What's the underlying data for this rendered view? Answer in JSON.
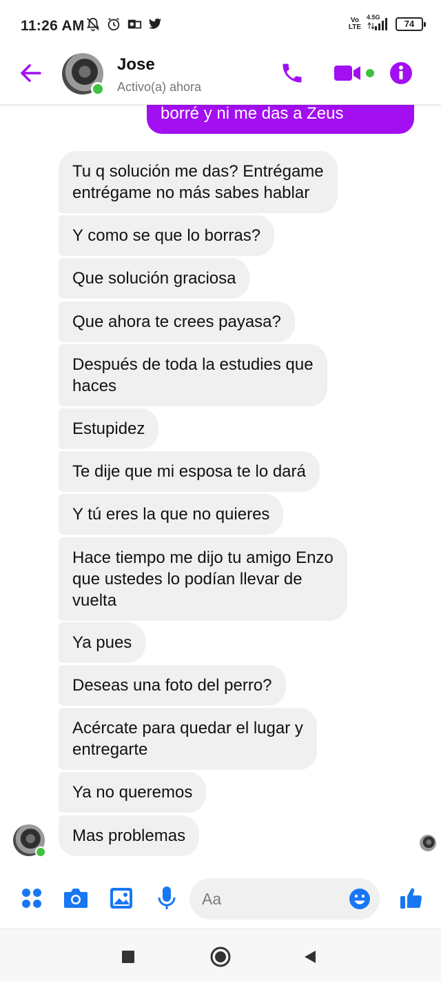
{
  "status_bar": {
    "time": "11:26 AM",
    "network_top": "Vo",
    "network_bottom": "LTE",
    "signal_label": "4.5G",
    "battery": "74"
  },
  "header": {
    "name": "Jose",
    "status": "Activo(a) ahora"
  },
  "colors": {
    "accent": "#a20ff0",
    "blue": "#1877f2",
    "online": "#3ec13f",
    "incoming_bubble": "#f0f0f0"
  },
  "messages": {
    "outgoing_partial": "borré y ni me das a Zeus",
    "incoming": [
      "Tu q solución me das? Entrégame\nentrégame no más sabes hablar",
      "Y como se que lo borras?",
      "Que solución graciosa",
      "Que ahora te crees payasa?",
      "Después de toda la estudies que\nhaces",
      "Estupidez",
      "Te dije que mi esposa te lo dará",
      "Y tú eres la que no quieres",
      "Hace tiempo me dijo tu amigo Enzo\nque ustedes lo podían llevar de\nvuelta",
      "Ya pues",
      "Deseas una foto del perro?",
      "Acércate para quedar el lugar y\nentregarte",
      "Ya no queremos",
      "Mas problemas"
    ]
  },
  "composer": {
    "placeholder": "Aa"
  },
  "icons": {
    "back": "arrow-left-icon",
    "call": "phone-icon",
    "video": "video-camera-icon",
    "info": "info-icon",
    "more": "four-dots-icon",
    "camera": "camera-icon",
    "gallery": "image-icon",
    "mic": "microphone-icon",
    "emoji": "smiley-icon",
    "like": "thumbs-up-icon"
  }
}
